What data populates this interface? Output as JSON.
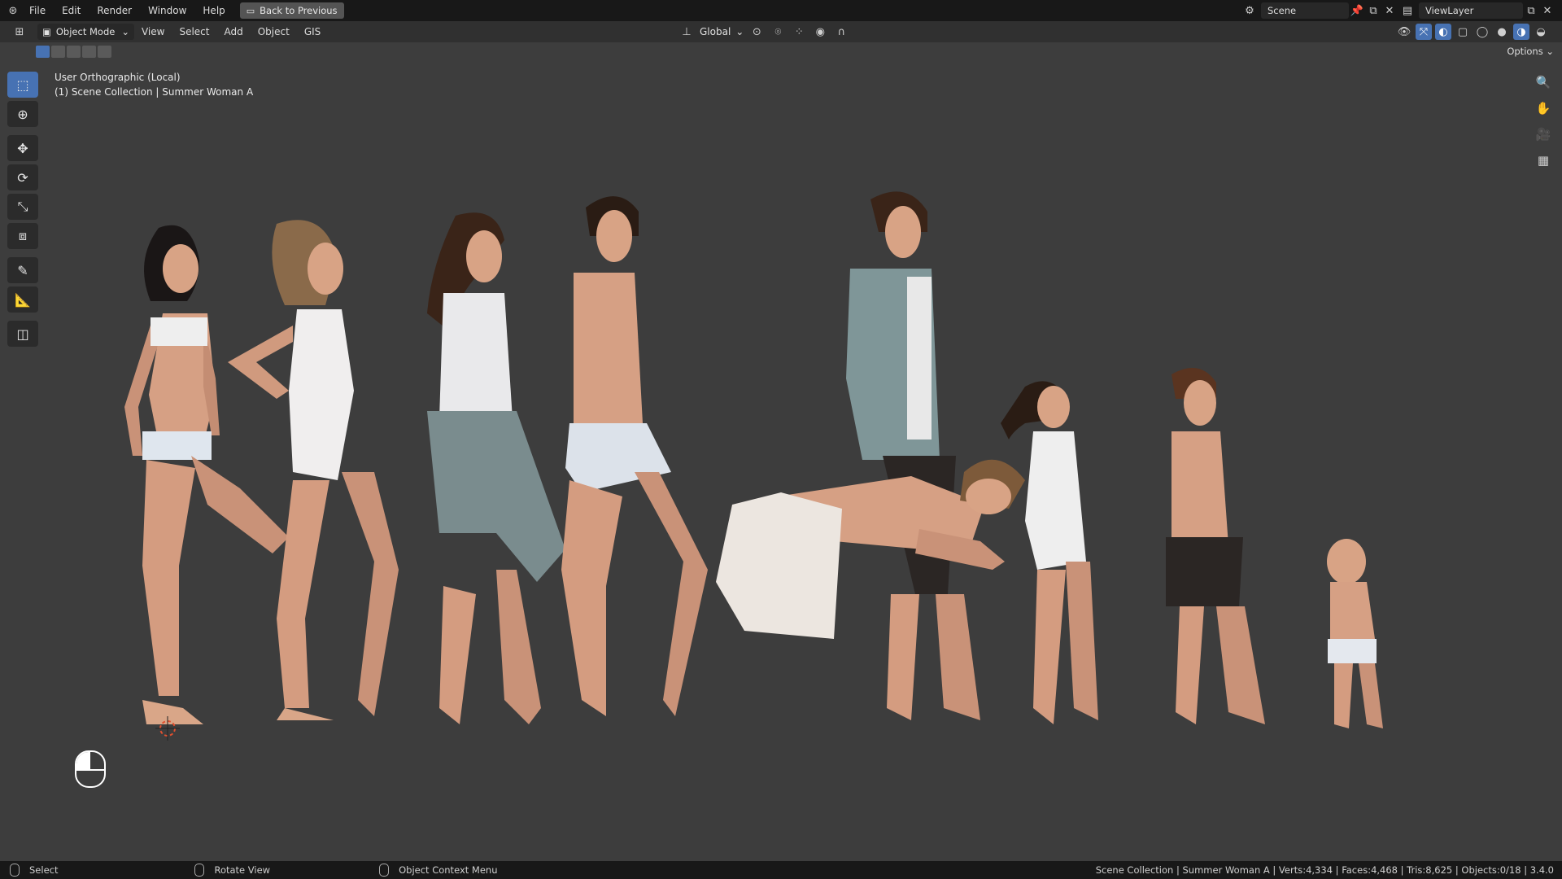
{
  "topbar": {
    "menus": [
      "File",
      "Edit",
      "Render",
      "Window",
      "Help"
    ],
    "back_button": "Back to Previous",
    "scene": "Scene",
    "view_layer": "ViewLayer"
  },
  "header": {
    "mode": "Object Mode",
    "menus": [
      "View",
      "Select",
      "Add",
      "Object",
      "GIS"
    ],
    "transform_orientation": "Global",
    "options": "Options"
  },
  "viewport": {
    "view_name": "User Orthographic (Local)",
    "collection_info": "(1) Scene Collection | Summer Woman A"
  },
  "toolbar": {
    "tools": [
      "select-box-icon",
      "cursor-icon",
      "move-icon",
      "rotate-icon",
      "scale-icon",
      "transform-icon",
      "annotate-icon",
      "measure-icon",
      "add-cube-icon"
    ]
  },
  "statusbar": {
    "select": "Select",
    "rotate_view": "Rotate View",
    "context_menu": "Object Context Menu",
    "stats": "Scene Collection | Summer Woman A | Verts:4,334 | Faces:4,468 | Tris:8,625 | Objects:0/18 | 3.4.0"
  },
  "colors": {
    "accent": "#4772b3",
    "viewport_bg": "#3d3d3d",
    "topbar_bg": "#181818",
    "header_bg": "#303030",
    "skin": "#d8a385"
  }
}
